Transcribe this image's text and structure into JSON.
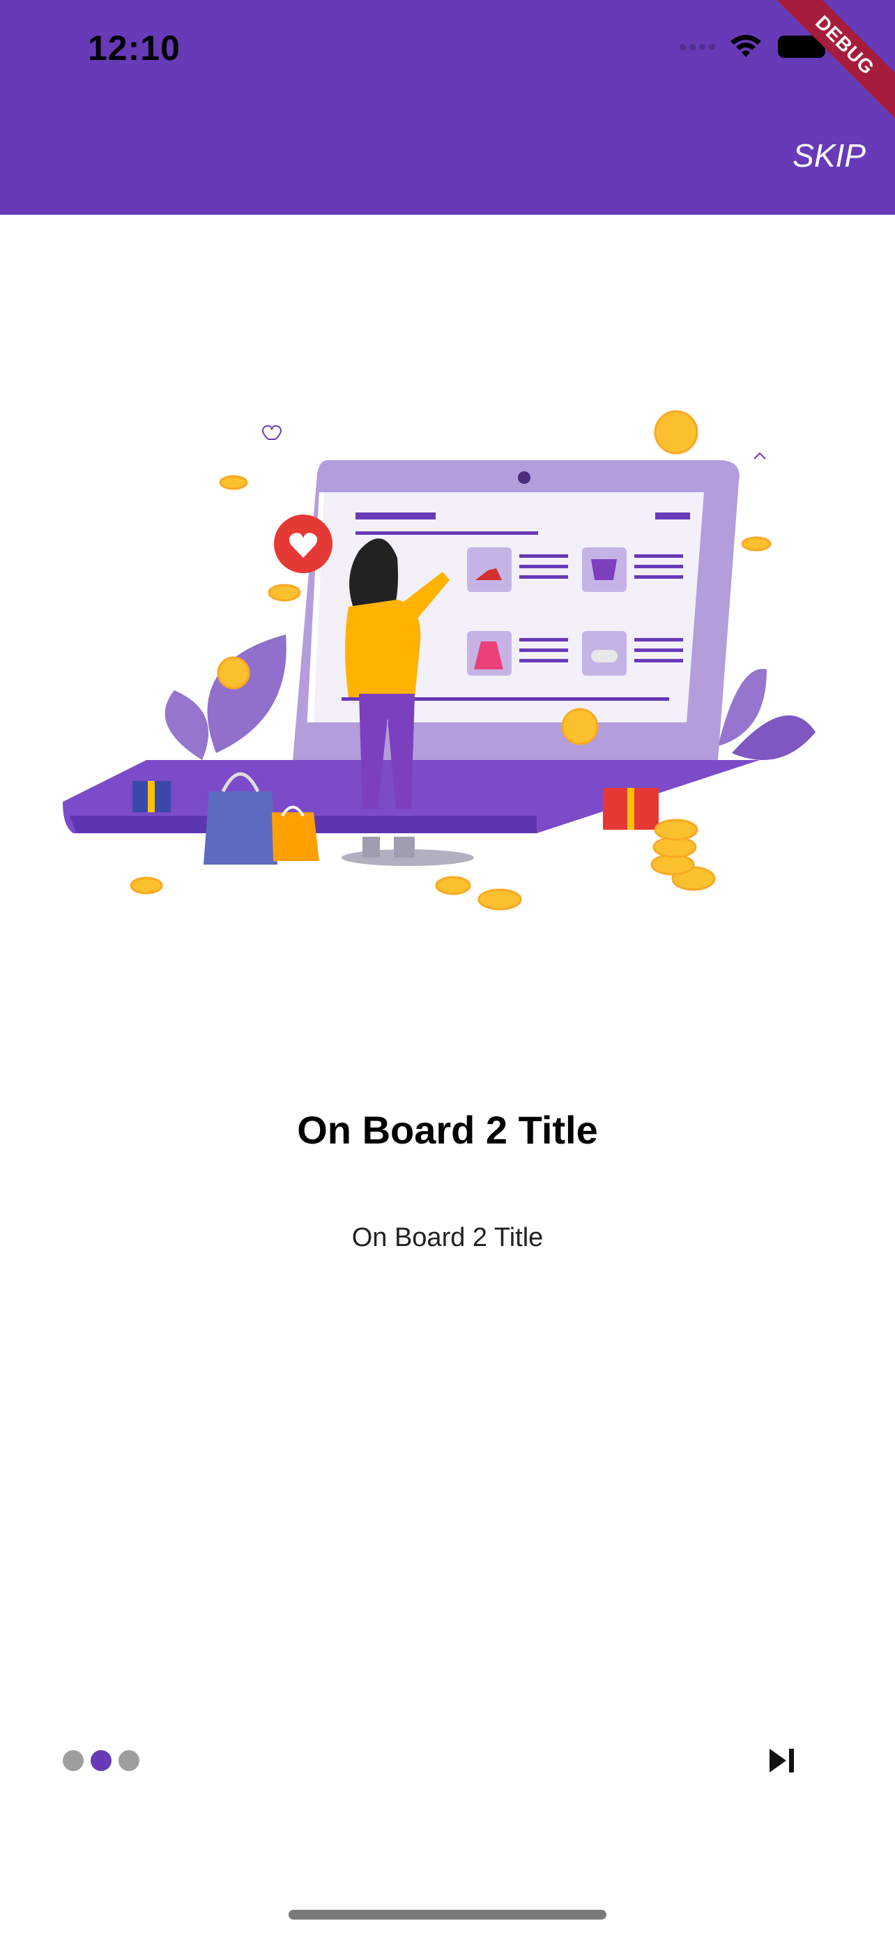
{
  "status_bar": {
    "time": "12:10"
  },
  "app_bar": {
    "skip_label": "SKIP",
    "color": "#673AB7"
  },
  "debug_banner": {
    "label": "DEBUG",
    "color": "#A61C3C"
  },
  "page": {
    "title": "On Board 2 Title",
    "subtitle": "On Board 2 Title"
  },
  "page_indicator": {
    "count": 3,
    "active_index": 1,
    "active_color": "#673AB7",
    "inactive_color": "#9E9E9E"
  },
  "icons": {
    "next": "skip-next-icon",
    "wifi": "wifi-icon",
    "battery": "battery-icon",
    "illustration": "online-shopping-illustration"
  }
}
